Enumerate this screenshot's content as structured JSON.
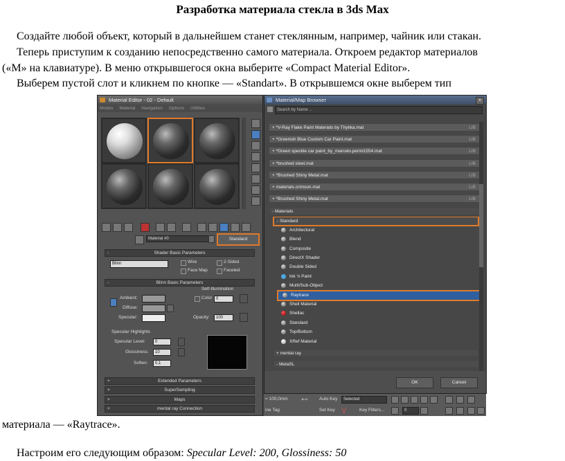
{
  "document": {
    "title": "Разработка материала стекла в 3ds Max",
    "para1": "Создайте любой объект, который в дальнейшем станет стеклянным, например, чайник или стакан.",
    "para2_l1": "Теперь приступим к созданию непосредственно самого материала. Откроем редактор материалов",
    "para2_l2": "(«M» на клавиатуре). В меню открывшегося окна выберите «Compact Material Editor».",
    "para3": "Выберем пустой слот и кликнем по кнопке — «Standart». В открывшемся окне выберем тип",
    "para4": "материала — «Raytrace».",
    "para5_prefix": "Настроим его следующим образом: ",
    "para5_italic": "Specular Level: 200, Glossiness: 50"
  },
  "material_editor": {
    "title": "Material Editor - 02 - Default",
    "menu": [
      "Modes",
      "Material",
      "Navigation",
      "Options",
      "Utilities"
    ],
    "material_name": "Material #0",
    "type_button": "Standard",
    "shader_rollout": "Shader Basic Parameters",
    "shader": "Blinn",
    "wire": "Wire",
    "two_sided": "2-Sided",
    "face_map": "Face Map",
    "faceted": "Faceted",
    "blinn_rollout": "Blinn Basic Parameters",
    "self_illum": "Self-Illumination",
    "color_lbl": "Color",
    "color_val": "0",
    "ambient": "Ambient:",
    "diffuse": "Diffuse:",
    "specular": "Specular:",
    "opacity_lbl": "Opacity:",
    "opacity_val": "100",
    "spec_highlights": "Specular Highlights",
    "spec_level_lbl": "Specular Level:",
    "spec_level_val": "0",
    "gloss_lbl": "Glossiness:",
    "gloss_val": "10",
    "soften_lbl": "Soften:",
    "soften_val": "0,1",
    "rollouts": [
      "Extended Parameters",
      "SuperSampling",
      "Maps",
      "mental ray Connection"
    ]
  },
  "browser": {
    "title": "Material/Map Browser",
    "search": "Search by Name ...",
    "libs": [
      "+ *V-Ray Flake Paint Materials by Thykka.mat",
      "+ *Greenish Blue Custom Car Paint.mat",
      "+ *Green speckle car paint_by_marcelo.perini1554.mat",
      "+ *brushed steel.mat",
      "+ *Brushed Shiny Metal.mat",
      "+ materials.crimson.mat",
      "+ *Brushed Shiny Metal.mat"
    ],
    "lib_tag": "LIB",
    "materials_group": "- Materials",
    "standard_group": "- Standard",
    "items": [
      "Architectural",
      "Blend",
      "Composite",
      "DirectX Shader",
      "Double Sided",
      "Ink 'n Paint",
      "Multi/Sub-Object",
      "Raytrace",
      "Shell Material",
      "Shellac",
      "Standard",
      "Top/Bottom",
      "XRef Material"
    ],
    "mental_ray": "+ mental ray",
    "metasl": "- MetaSL",
    "ok": "OK",
    "cancel": "Cancel"
  },
  "statusbar": {
    "coord": "= 100,0mm",
    "line_tag": "ine Tag",
    "auto_key": "Auto Key",
    "selected": "Selected",
    "set_key": "Set Key",
    "key_filters": "Key Filters...",
    "frame": "0"
  },
  "colors": {
    "highlight": "#e07a2a",
    "selected_row": "#2f5f9e"
  }
}
